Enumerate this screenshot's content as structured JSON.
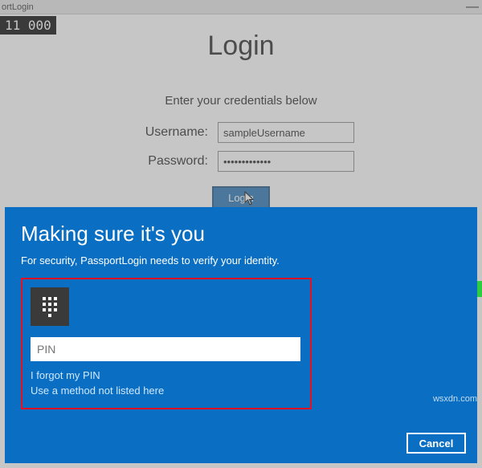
{
  "window": {
    "title_fragment": "ortLogin",
    "counter": "11  000"
  },
  "login": {
    "title": "Login",
    "subtitle": "Enter your credentials below",
    "username_label": "Username:",
    "username_value": "sampleUsername",
    "password_label": "Password:",
    "password_value": "•••••••••••••",
    "button": "Login"
  },
  "dialog": {
    "heading": "Making sure it's you",
    "description": "For security, PassportLogin needs to verify your identity.",
    "pin_placeholder": "PIN",
    "forgot_link": "I forgot my PIN",
    "other_method_link": "Use a method not listed here",
    "cancel": "Cancel"
  },
  "watermark": "wsxdn.com"
}
